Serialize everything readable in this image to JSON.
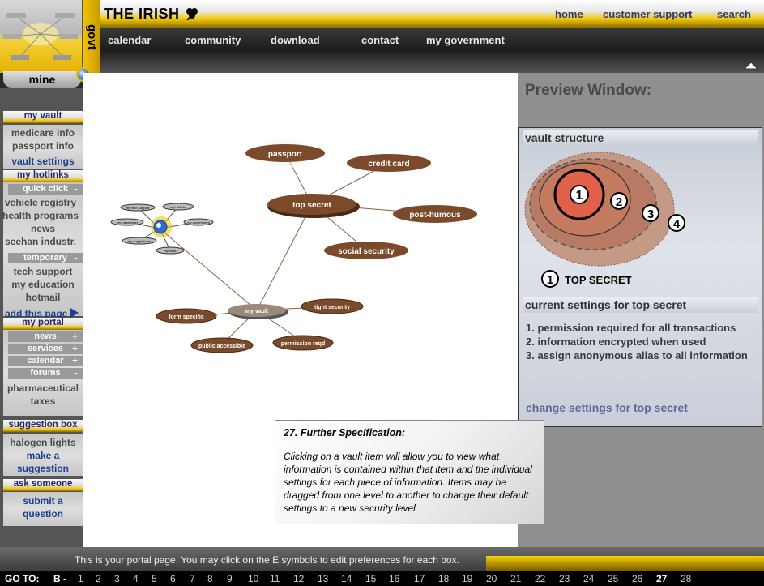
{
  "header": {
    "brand": "THE IRISH",
    "govt_tab": "govt",
    "top_links": [
      "home",
      "customer support",
      "search"
    ],
    "nav": [
      "calendar",
      "community",
      "download",
      "contact",
      "my government"
    ],
    "mine_tab": "mine"
  },
  "sidebar": {
    "my_vault": {
      "title": "my vault",
      "items": [
        "medicare info",
        "passport info"
      ],
      "settings_link": "vault settings"
    },
    "my_hotlinks": {
      "title": "my hotlinks",
      "quick_click": "quick click",
      "quick_items": [
        "vehicle registry",
        "health programs",
        "news",
        "seehan industr."
      ],
      "temporary": "temporary",
      "temp_items": [
        "tech support",
        "my education",
        "hotmail"
      ],
      "add_page": "add this page"
    },
    "my_portal": {
      "title": "my portal",
      "sections": [
        "news",
        "services",
        "calendar",
        "forums"
      ],
      "forum_items": [
        "pharmaceutical taxes"
      ]
    },
    "suggestion_box": {
      "title": "suggestion box",
      "item": "halogen lights",
      "action": "make a suggestion"
    },
    "ask_someone": {
      "title": "ask someone",
      "action": "submit a question"
    }
  },
  "vault_map": {
    "center": "my vault",
    "top_secret": "top secret",
    "top_secret_children": [
      "passport",
      "credit card",
      "post-humous",
      "social security"
    ],
    "other_nodes": [
      "form specific",
      "tight security",
      "public accessible",
      "permission reqd"
    ],
    "mini_nodes": [
      "my tech support",
      "my hotlinks",
      "my messenger",
      "my government",
      "my suggestions",
      "my vault"
    ]
  },
  "preview": {
    "title": "Preview Window:",
    "structure_label": "vault structure",
    "levels": [
      "1",
      "2",
      "3",
      "4"
    ],
    "selected_number": "1",
    "selected_label": "TOP SECRET",
    "settings_header": "current settings for top secret",
    "settings": [
      "1. permission required for all transactions",
      "2. information encrypted when used",
      "3. assign anonymous alias to all information"
    ],
    "change_link": "change settings for top secret"
  },
  "note": {
    "title": "27. Further Specification:",
    "body": "Clicking on a vault item will allow you to view what information is contained within that item and the individual settings for each piece of information. Items may be dragged from one level to another to change their default settings to a new security level."
  },
  "status": "This is your portal page. You may click on the E symbols to edit preferences for each box.",
  "goto": {
    "label": "GO TO:",
    "prefix": "B -",
    "pages": [
      "1",
      "2",
      "3",
      "4",
      "5",
      "6",
      "7",
      "8",
      "9",
      "10",
      "11",
      "12",
      "13",
      "14",
      "15",
      "16",
      "17",
      "18",
      "19",
      "20",
      "21",
      "22",
      "23",
      "24",
      "25",
      "26",
      "27",
      "28"
    ],
    "current": "27"
  },
  "colors": {
    "gold": "#f2c400",
    "node_brown": "#7a4a2a",
    "accent_blue": "#1d3f8f"
  }
}
